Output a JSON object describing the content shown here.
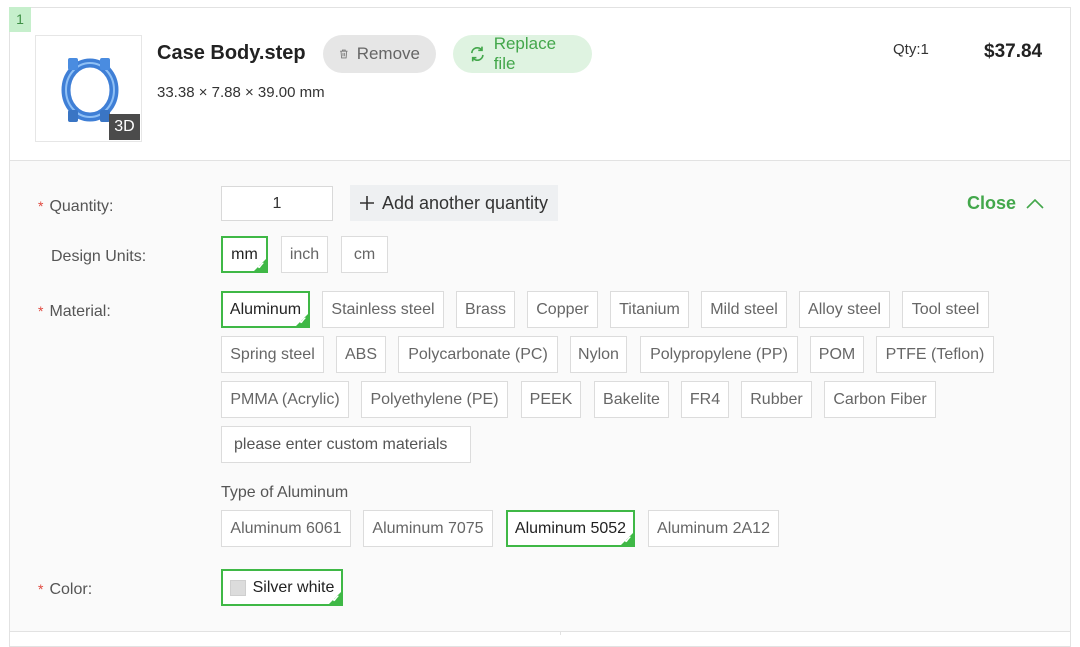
{
  "item": {
    "index": "1",
    "thumb_badge": "3D",
    "file_name": "Case Body.step",
    "dimensions": "33.38 × 7.88 × 39.00 mm",
    "remove_label": "Remove",
    "replace_label": "Replace file",
    "qty_summary": "Qty:1",
    "price": "$37.84"
  },
  "config": {
    "required_mark": "*",
    "quantity_label": "Quantity:",
    "quantity_value": "1",
    "add_quantity_label": "Add another quantity",
    "close_label": "Close",
    "design_units_label": "Design Units:",
    "units": [
      "mm",
      "inch",
      "cm"
    ],
    "selected_unit": "mm",
    "material_label": "Material:",
    "materials": [
      "Aluminum",
      "Stainless steel",
      "Brass",
      "Copper",
      "Titanium",
      "Mild steel",
      "Alloy steel",
      "Tool steel",
      "Spring steel",
      "ABS",
      "Polycarbonate (PC)",
      "Nylon",
      "Polypropylene (PP)",
      "POM",
      "PTFE (Teflon)",
      "PMMA (Acrylic)",
      "Polyethylene (PE)",
      "PEEK",
      "Bakelite",
      "FR4",
      "Rubber",
      "Carbon Fiber"
    ],
    "selected_material": "Aluminum",
    "custom_material_placeholder": "please enter custom materials",
    "type_label": "Type of Aluminum",
    "types": [
      "Aluminum 6061",
      "Aluminum 7075",
      "Aluminum 5052",
      "Aluminum 2A12"
    ],
    "selected_type": "Aluminum 5052",
    "color_label": "Color:",
    "color_value": "Silver white",
    "color_swatch": "#dcdcdc"
  },
  "colors": {
    "accent_green": "#3fb846",
    "required_red": "#e0483e"
  }
}
